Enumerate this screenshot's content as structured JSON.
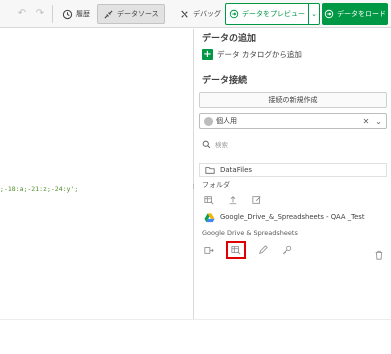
{
  "toolbar": {
    "history_label": "履歴",
    "datasource_label": "データソース",
    "debug_label": "デバッグ",
    "preview_label": "データをプレビュー",
    "load_label": "データをロード",
    "accent_color": "#009845"
  },
  "editor": {
    "code_fragment": ";-18:a;-21:z;-24:y';"
  },
  "panel": {
    "add_data_title": "データの追加",
    "add_from_catalog": "データ カタログから追加",
    "connections_title": "データ接続",
    "new_connection_button": "接続の新規作成",
    "space_selected": "個人用",
    "search_placeholder": "検索",
    "folder_connection": {
      "name": "DataFiles",
      "type_label": "フォルダ"
    },
    "drive_connection": {
      "name": "Google_Drive_&_Spreadsheets - QAA _Test",
      "type_label": "Google Drive & Spreadsheets"
    }
  },
  "icons": {
    "highlight_color": "#e00000"
  }
}
